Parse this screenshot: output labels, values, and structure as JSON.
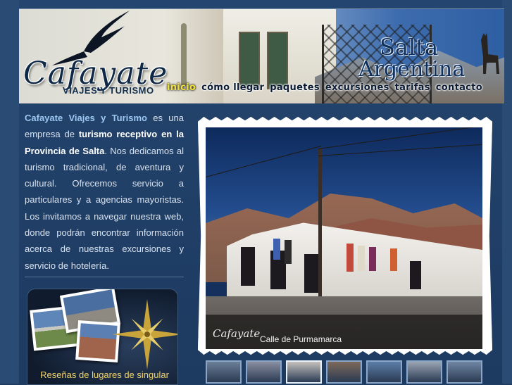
{
  "header": {
    "logo_name": "Cafayate",
    "logo_tagline": "Viajes y Turismo",
    "region_line1": "Salta",
    "region_line2": "Argentina"
  },
  "nav": {
    "items": [
      {
        "label": "inicio",
        "active": true
      },
      {
        "label": "cómo llegar",
        "active": false
      },
      {
        "label": "paquetes",
        "active": false
      },
      {
        "label": "excursiones",
        "active": false
      },
      {
        "label": "tarifas",
        "active": false
      },
      {
        "label": "contacto",
        "active": false
      }
    ]
  },
  "intro": {
    "brand": "Cafayate Viajes y Turismo",
    "t1": " es una empresa de ",
    "strong": "turismo receptivo en la Provincia de Salta",
    "t2": ". Nos dedicamos al turismo tradicional, de aventura y cultural. Ofrecemos servicio a particulares y a agencias mayoristas. Los invitamos a navegar nuestra web, donde podrán encontrar información acerca de nuestras excursiones y servicio de hotelería."
  },
  "promo": {
    "text": "Reseñas de lugares de singular"
  },
  "photo": {
    "caption": "Calle de Purmamarca",
    "watermark": "Cafayate"
  },
  "thumbnails": {
    "count_note": "",
    "colors": [
      "#6b7f98",
      "#8a8ea0",
      "#c4c2bd",
      "#7d6a5a",
      "#5c7ea8",
      "#9aa4b2",
      "#6f86a3"
    ],
    "selected_index": 2
  },
  "colors": {
    "background": "#1f3c63",
    "nav_active": "#f0e23a",
    "link_highlight": "#9bc7f0",
    "promo_text": "#f2d46b"
  }
}
